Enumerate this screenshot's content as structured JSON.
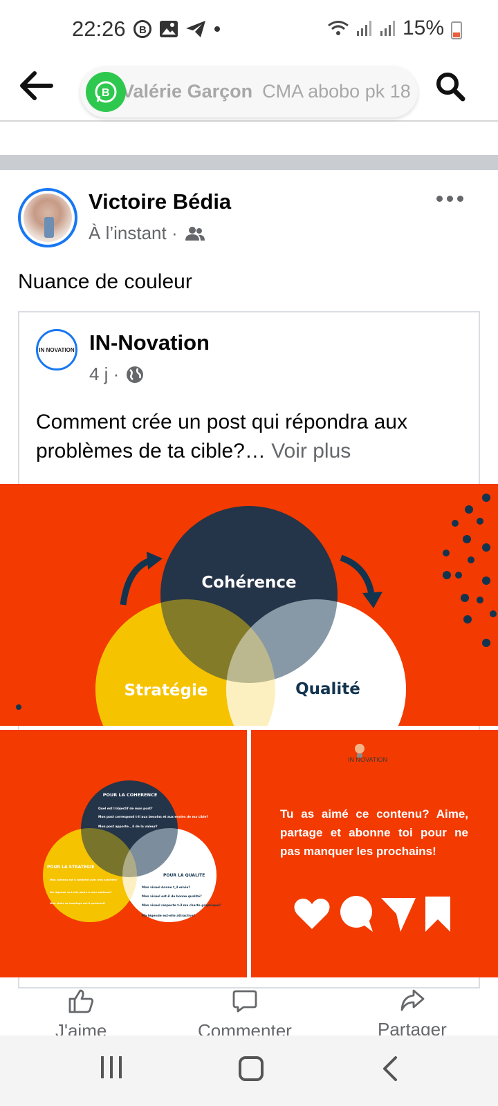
{
  "status_bar": {
    "time": "22:26",
    "battery": "15%",
    "icons": [
      "business-b-icon",
      "gallery-icon",
      "telegram-icon",
      "dot-icon",
      "wifi-icon",
      "signal-icon",
      "battery-icon"
    ]
  },
  "top_bar": {
    "chat_name": "Valérie Garçon",
    "chat_subtitle": "CMA abobo pk 18",
    "accent": "#2fc84f"
  },
  "post": {
    "author": "Victoire Bédia",
    "time": "À l’instant ·",
    "text": "Nuance de couleur",
    "shared": {
      "author": "IN-Novation",
      "time": "4 j ·",
      "text": "Comment crée un post qui répondra aux problèmes de ta cible?…",
      "see_more": "Voir plus",
      "avatar_text": "IN NOVATION"
    }
  },
  "images": {
    "main": {
      "labels": [
        "Cohérence",
        "Stratégie",
        "Qualité"
      ],
      "colors": {
        "background": "#f33a00",
        "navy": "#12344f",
        "yellow": "#f6c400",
        "white": "#ffffff"
      }
    },
    "detail": {
      "coherence_title": "POUR LA COHERENCE",
      "coherence_items": [
        "Quel est l'objectif de mon post?",
        "Mon post correspond t-il aux besoins et aux envies de ma cible?",
        "Mon post apporte _ il de la valeur?"
      ],
      "strategie_title": "POUR LA STRATEGIE",
      "strategie_items": [
        "Mon contenu est il cohérent avec mes activités?",
        "Ma légende va t-elle plaire à mon audience?",
        "Mon choix de hashtags est-il pertinent?"
      ],
      "qualite_title": "POUR LA QUALITE",
      "qualite_items": [
        "Mon visuel donne t_il envie?",
        "Mon visuel est-il de bonne qualité?",
        "Mon visuel respecte t-il ma charte graphique?",
        "Ma légende est-elle attractive?"
      ]
    },
    "cta": {
      "brand": "IN NOVATION",
      "text": "Tu as aimé ce contenu? Aime, partage et abonne toi pour ne pas manquer les prochains!"
    }
  },
  "actions": {
    "like": "J'aime",
    "comment": "Commenter",
    "share": "Partager"
  }
}
